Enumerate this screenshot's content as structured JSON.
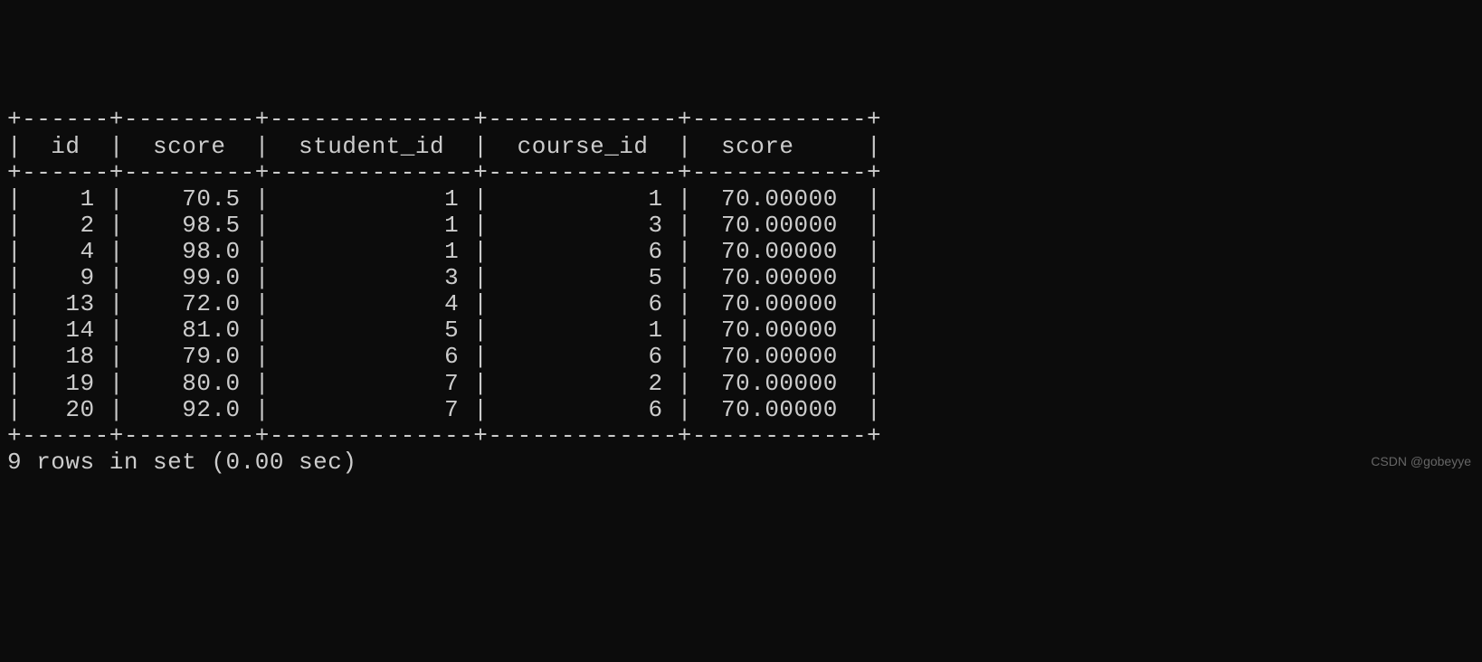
{
  "table": {
    "border_top": "+------+---------+--------------+-------------+------------+",
    "border_mid": "+------+---------+--------------+-------------+------------+",
    "border_bottom": "+------+---------+--------------+-------------+------------+",
    "header": "|  id  |  score  |  student_id  |  course_id  |  score     |",
    "rows": [
      "|    1 |    70.5 |            1 |           1 |  70.00000  |",
      "|    2 |    98.5 |            1 |           3 |  70.00000  |",
      "|    4 |    98.0 |            1 |           6 |  70.00000  |",
      "|    9 |    99.0 |            3 |           5 |  70.00000  |",
      "|   13 |    72.0 |            4 |           6 |  70.00000  |",
      "|   14 |    81.0 |            5 |           1 |  70.00000  |",
      "|   18 |    79.0 |            6 |           6 |  70.00000  |",
      "|   19 |    80.0 |            7 |           2 |  70.00000  |",
      "|   20 |    92.0 |            7 |           6 |  70.00000  |"
    ],
    "columns": [
      "id",
      "score",
      "student_id",
      "course_id",
      "score"
    ],
    "data": [
      {
        "id": 1,
        "score": 70.5,
        "student_id": 1,
        "course_id": 1,
        "score2": "70.00000"
      },
      {
        "id": 2,
        "score": 98.5,
        "student_id": 1,
        "course_id": 3,
        "score2": "70.00000"
      },
      {
        "id": 4,
        "score": 98.0,
        "student_id": 1,
        "course_id": 6,
        "score2": "70.00000"
      },
      {
        "id": 9,
        "score": 99.0,
        "student_id": 3,
        "course_id": 5,
        "score2": "70.00000"
      },
      {
        "id": 13,
        "score": 72.0,
        "student_id": 4,
        "course_id": 6,
        "score2": "70.00000"
      },
      {
        "id": 14,
        "score": 81.0,
        "student_id": 5,
        "course_id": 1,
        "score2": "70.00000"
      },
      {
        "id": 18,
        "score": 79.0,
        "student_id": 6,
        "course_id": 6,
        "score2": "70.00000"
      },
      {
        "id": 19,
        "score": 80.0,
        "student_id": 7,
        "course_id": 2,
        "score2": "70.00000"
      },
      {
        "id": 20,
        "score": 92.0,
        "student_id": 7,
        "course_id": 6,
        "score2": "70.00000"
      }
    ]
  },
  "status": "9 rows in set (0.00 sec)",
  "watermark": "CSDN @gobeyye"
}
